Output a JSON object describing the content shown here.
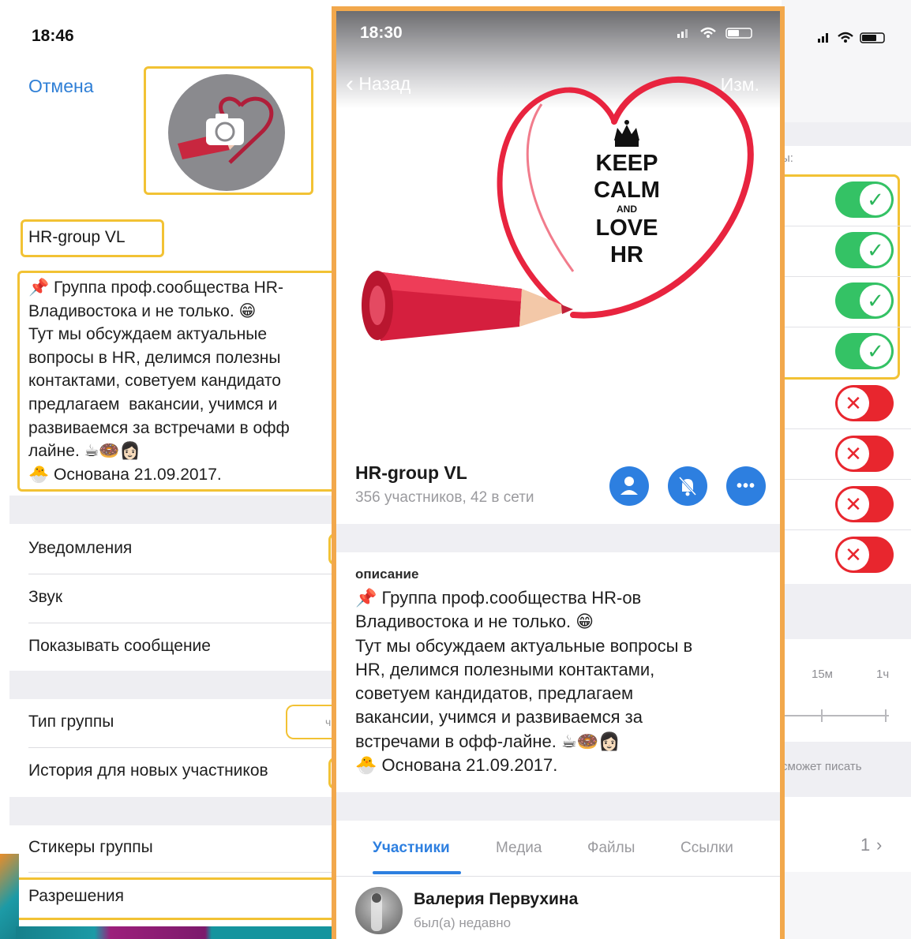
{
  "left_panel": {
    "time": "18:46",
    "cancel_label": "Отмена",
    "group_name": "HR-group VL",
    "description": "📌 Группа проф.сообщества HR-\nВладивостока и не только. 😁\nТут мы обсуждаем актуальные\nвопросы в HR, делимся полезны\nконтактами, советуем кандидато\nпредлагаем  вакансии, учимся и\nразвиваемся за встречами в офф\nлайне. ☕🍩👩🏻\n🐣 Основана 21.09.2017.",
    "items": {
      "notifications": "Уведомления",
      "sound": "Звук",
      "show_message": "Показывать сообщение",
      "group_type": "Тип группы",
      "history": "История для новых участников",
      "stickers": "Стикеры группы",
      "permissions": "Разрешения"
    }
  },
  "center_panel": {
    "time": "18:30",
    "back_label": "Назад",
    "edit_label": "Изм.",
    "hero_text": [
      "KEEP",
      "CALM",
      "AND",
      "LOVE",
      "HR"
    ],
    "group_title": "HR-group VL",
    "members_info": "356 участников, 42 в сети",
    "description_label": "описание",
    "description": "📌 Группа проф.сообщества HR-ов\nВладивостока и не только. 😁\nТут мы обсуждаем актуальные вопросы в\nHR, делимся полезными контактами,\nсоветуем кандидатов, предлагаем\nвакансии, учимся и развиваемся за\nвстречами в офф-лайне. ☕🍩👩🏻\n🐣 Основана 21.09.2017.",
    "tabs": [
      "Участники",
      "Медиа",
      "Файлы",
      "Ссылки"
    ],
    "active_tab": "Участники",
    "member": {
      "name": "Валерия Первухина",
      "status": "был(а) недавно"
    }
  },
  "right_panel": {
    "partial_label": "ы:",
    "toggles": [
      true,
      true,
      true,
      true,
      false,
      false,
      false,
      false
    ],
    "slow_mode_labels": [
      "15м",
      "1ч"
    ],
    "footer_text": "сможет писать",
    "count": "1"
  },
  "colors": {
    "highlight": "#f2c234",
    "frame": "#f2a84c",
    "accent": "#2d7fe0",
    "toggle_on": "#34c265",
    "toggle_off": "#e8262e",
    "link": "#2f7fd6"
  }
}
